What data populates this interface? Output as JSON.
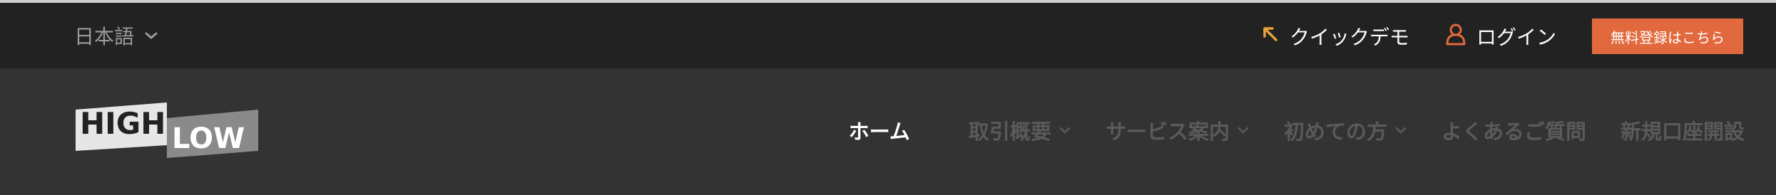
{
  "topbar": {
    "language": "日本語",
    "quick_demo": "クイックデモ",
    "login": "ログイン",
    "signup": "無料登録はこちら"
  },
  "logo": {
    "high": "HIGH",
    "low": "LOW"
  },
  "nav": {
    "items": [
      {
        "label": "ホーム"
      },
      {
        "label": "取引概要"
      },
      {
        "label": "サービス案内"
      },
      {
        "label": "初めての方"
      },
      {
        "label": "よくあるご質問"
      },
      {
        "label": "新規口座開設"
      }
    ]
  },
  "colors": {
    "accent": "#e2693e",
    "demo_icon": "#e8a23a",
    "topbar_bg": "#222222",
    "navbar_bg": "#333333"
  },
  "icons": {
    "language_dropdown": "chevron-down-icon",
    "quick_demo": "arrow-up-left-icon",
    "login": "user-icon",
    "nav_dropdown": "chevron-down-icon"
  }
}
